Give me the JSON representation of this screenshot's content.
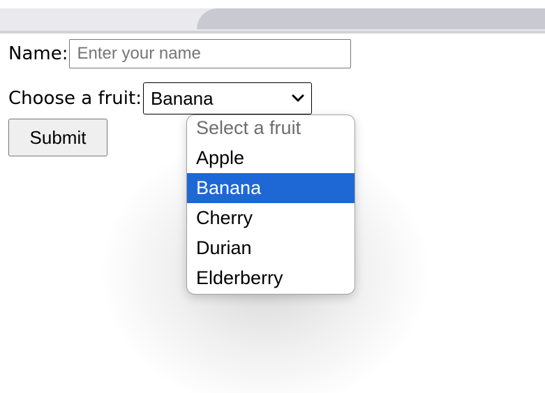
{
  "form": {
    "name_label": "Name:",
    "name_placeholder": "Enter your name",
    "name_value": "",
    "fruit_label": "Choose a fruit:",
    "fruit_selected": "Banana",
    "submit_label": "Submit"
  },
  "dropdown": {
    "options": [
      {
        "label": "Select a fruit",
        "placeholder": true,
        "selected": false
      },
      {
        "label": "Apple",
        "placeholder": false,
        "selected": false
      },
      {
        "label": "Banana",
        "placeholder": false,
        "selected": true
      },
      {
        "label": "Cherry",
        "placeholder": false,
        "selected": false
      },
      {
        "label": "Durian",
        "placeholder": false,
        "selected": false
      },
      {
        "label": "Elderberry",
        "placeholder": false,
        "selected": false
      }
    ],
    "highlight_color": "#1e68d6"
  },
  "icons": {
    "select_arrow": "chevron-down-icon"
  }
}
